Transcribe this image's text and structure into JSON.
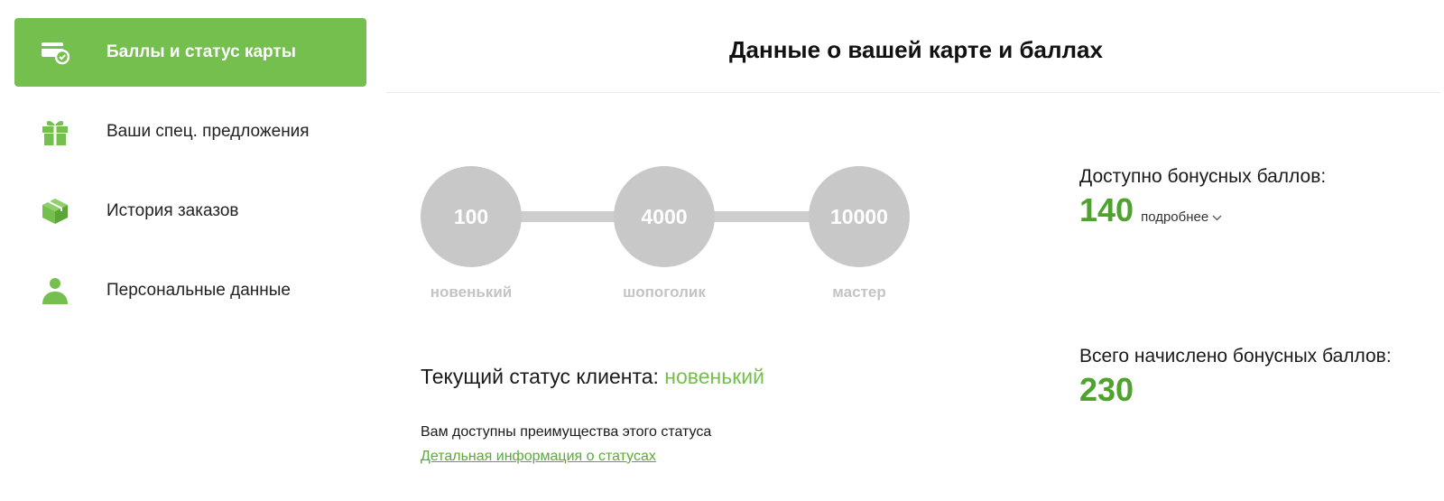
{
  "colors": {
    "accent": "#74bf4d",
    "inactive": "#c8c8c8",
    "text": "#1a1a1a",
    "value": "#4ea22d"
  },
  "sidebar": {
    "items": [
      {
        "label": "Баллы и статус карты",
        "icon": "card-status-icon",
        "active": true
      },
      {
        "label": "Ваши спец. предложения",
        "icon": "gift-icon",
        "active": false
      },
      {
        "label": "История заказов",
        "icon": "box-icon",
        "active": false
      },
      {
        "label": "Персональные данные",
        "icon": "user-icon",
        "active": false
      }
    ]
  },
  "header": {
    "title": "Данные о вашей карте и баллах"
  },
  "progress": {
    "fill_fraction": 0.12,
    "steps": [
      {
        "value": "100",
        "name": "новенький",
        "active": true
      },
      {
        "value": "4000",
        "name": "шопоголик",
        "active": false
      },
      {
        "value": "10000",
        "name": "мастер",
        "active": false
      }
    ]
  },
  "status": {
    "label": "Текущий статус клиента:",
    "value": "новенький",
    "benefits_text": "Вам доступны преимущества этого статуса",
    "details_link": "Детальная информация о статусах"
  },
  "stats": {
    "available_label": "Доступно бонусных баллов:",
    "available_value": "140",
    "more_label": "подробнее",
    "total_label": "Всего начислено бонусных баллов:",
    "total_value": "230"
  }
}
